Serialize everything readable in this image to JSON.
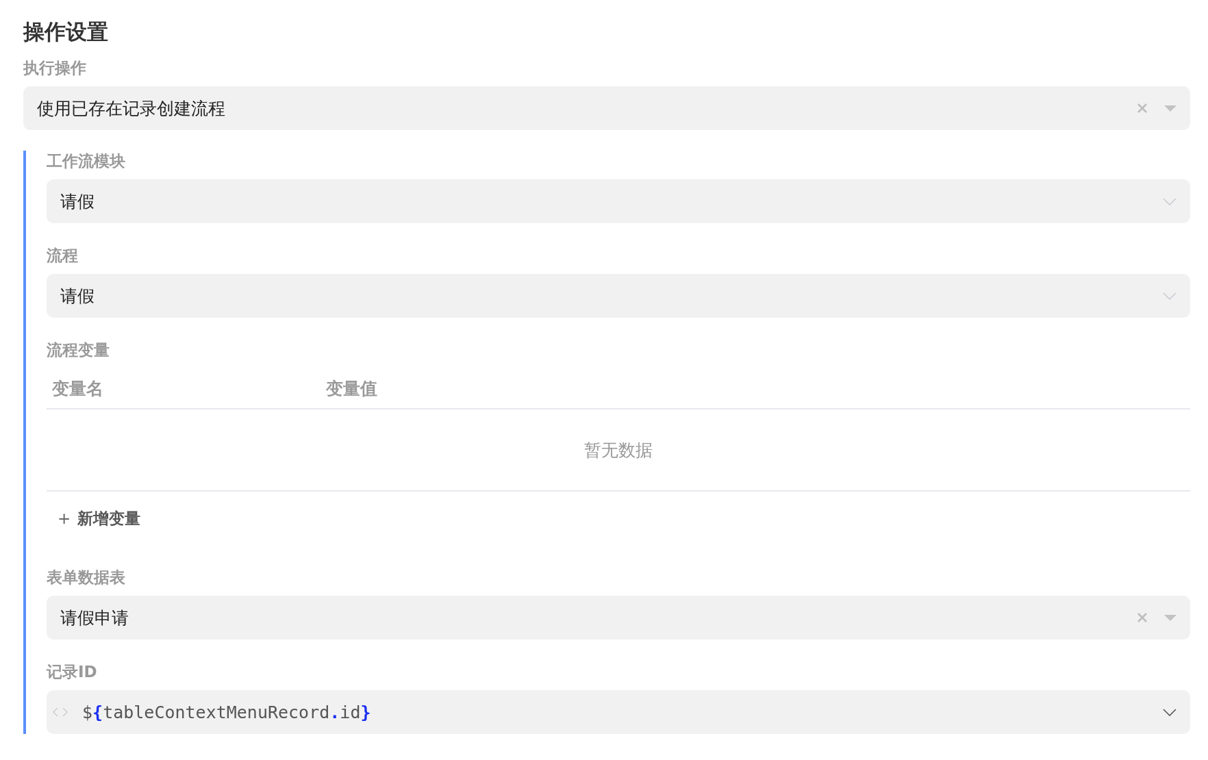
{
  "title": "操作设置",
  "action": {
    "label": "执行操作",
    "value": "使用已存在记录创建流程",
    "clearable": true
  },
  "fields": [
    {
      "label": "工作流模块",
      "value": "请假",
      "clearable": false
    },
    {
      "label": "流程",
      "value": "请假",
      "clearable": false
    }
  ],
  "variables": {
    "label": "流程变量",
    "columns": [
      "变量名",
      "变量值"
    ],
    "empty_text": "暂无数据",
    "add_icon": "+",
    "add_label": "新增变量"
  },
  "form_table": {
    "label": "表单数据表",
    "value": "请假申请",
    "clearable": true
  },
  "record_id": {
    "label": "记录ID",
    "tokens": [
      {
        "kind": "text",
        "text": "$"
      },
      {
        "kind": "punct",
        "text": "{"
      },
      {
        "kind": "text",
        "text": "tableContextMenuRecord"
      },
      {
        "kind": "punct",
        "text": "."
      },
      {
        "kind": "text",
        "text": "id"
      },
      {
        "kind": "punct",
        "text": "}"
      }
    ]
  }
}
